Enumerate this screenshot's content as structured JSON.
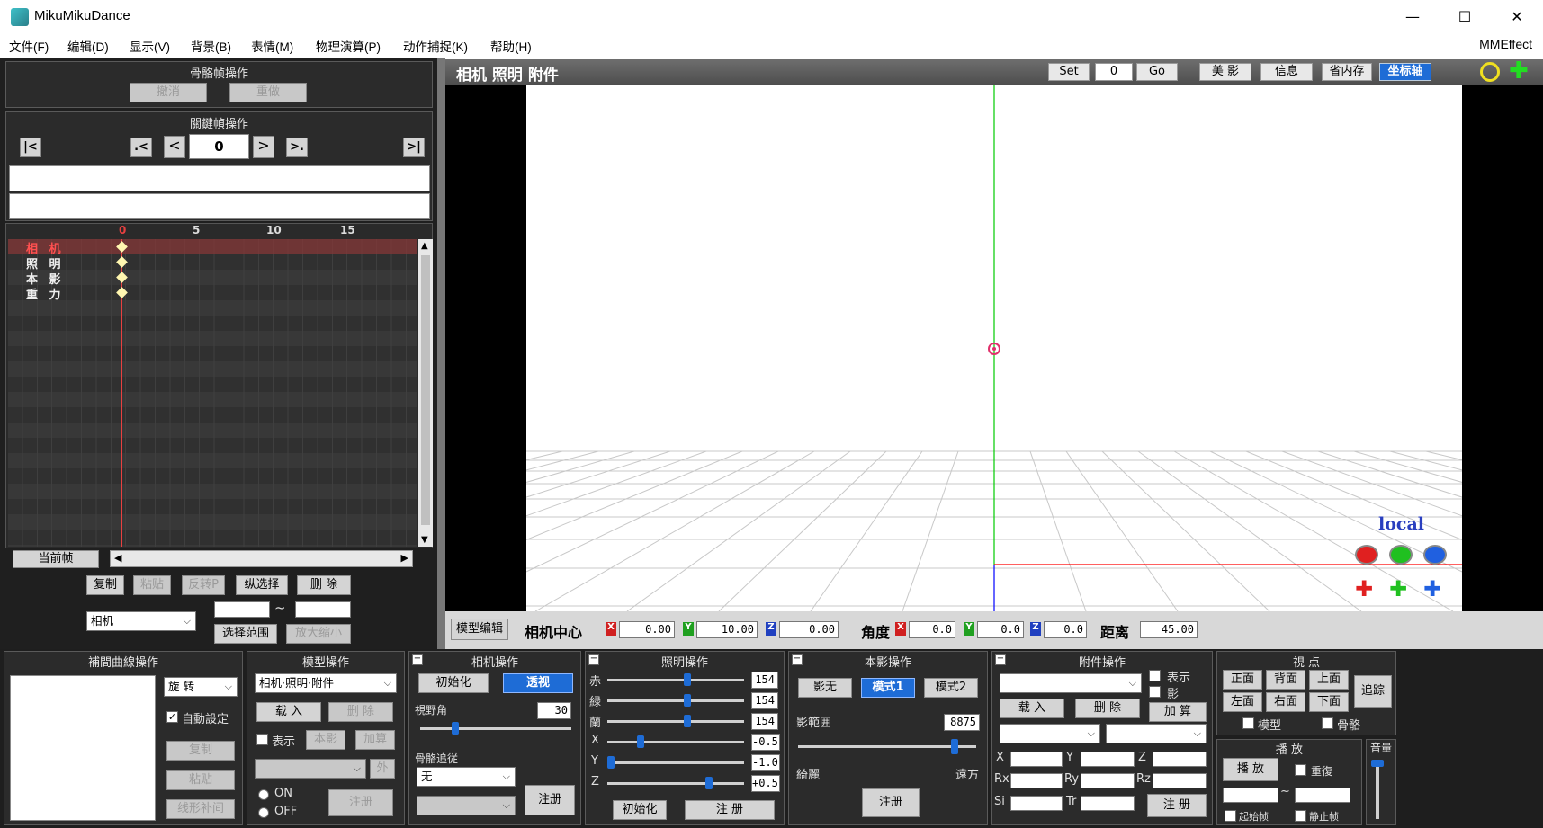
{
  "window": {
    "title": "MikuMikuDance",
    "controls": {
      "minimize": "—",
      "maximize": "☐",
      "close": "✕"
    }
  },
  "menu": {
    "items": [
      "文件(F)",
      "编辑(D)",
      "显示(V)",
      "背景(B)",
      "表情(M)",
      "物理演算(P)",
      "动作捕捉(K)",
      "帮助(H)"
    ],
    "right": "MMEffect"
  },
  "bone_frame_ops": {
    "title": "骨骼帧操作",
    "undo": "撤消",
    "redo": "重做"
  },
  "keyframe_ops": {
    "title": "關鍵幀操作",
    "first": "|<",
    "prev_key": ".<",
    "prev": "<",
    "frame": "0",
    "next": ">",
    "next_key": ">.",
    "last": ">|"
  },
  "timeline": {
    "ticks": [
      "0",
      "5",
      "10",
      "15"
    ],
    "rows": [
      "相 机",
      "照 明",
      "本 影",
      "重 力"
    ],
    "current_frame_btn": "当前帧"
  },
  "timeline_ops": {
    "copy": "复制",
    "paste": "粘贴",
    "reverse_paste": "反转P",
    "vertical_select": "纵选择",
    "delete": "删 除",
    "target": "相机",
    "range_sep": "~",
    "select_range": "选择范围",
    "zoom": "放大缩小"
  },
  "viewport": {
    "title": "相机 照明 附件",
    "set": "Set",
    "frame": "0",
    "go": "Go",
    "beauty": "美 影",
    "info": "信息",
    "save_mem": "省内存",
    "axis": "坐标轴",
    "local_label": "local"
  },
  "camera_bar": {
    "model_edit": "模型编辑",
    "center_label": "相机中心",
    "cx": "0.00",
    "cy": "10.00",
    "cz": "0.00",
    "angle_label": "角度",
    "ax": "0.0",
    "ay": "0.0",
    "az": "0.0",
    "distance_label": "距离",
    "distance": "45.00",
    "x": "X",
    "y": "Y",
    "z": "Z"
  },
  "interp": {
    "title": "補間曲線操作",
    "type": "旋 转",
    "auto": "自動設定",
    "copy": "复制",
    "paste": "粘贴",
    "linear": "线形补间"
  },
  "model_ops": {
    "title": "模型操作",
    "model": "相机·照明·附件",
    "load": "载 入",
    "delete": "删 除",
    "show": "表示",
    "shadow": "本影",
    "add": "加算",
    "outside": "外",
    "on": "ON",
    "off": "OFF",
    "register": "注册"
  },
  "camera_ops": {
    "title": "相机操作",
    "init": "初始化",
    "perspective": "透视",
    "fov_label": "視野角",
    "fov": "30",
    "bone_follow": "骨骼追従",
    "follow_target": "无",
    "register": "注册"
  },
  "light_ops": {
    "title": "照明操作",
    "r_label": "赤",
    "g_label": "緑",
    "b_label": "蘭",
    "r": "154",
    "g": "154",
    "b": "154",
    "x_label": "X",
    "y_label": "Y",
    "z_label": "Z",
    "x": "-0.5",
    "y": "-1.0",
    "z": "+0.5",
    "init": "初始化",
    "register": "注 册"
  },
  "shadow_ops": {
    "title": "本影操作",
    "none": "影无",
    "mode1": "模式1",
    "mode2": "模式2",
    "range_label": "影範囲",
    "range": "8875",
    "near": "綺麗",
    "far": "遠方",
    "register": "注册"
  },
  "accessory_ops": {
    "title": "附件操作",
    "show": "表示",
    "shadow": "影",
    "load": "载 入",
    "delete": "删 除",
    "add": "加 算",
    "x": "X",
    "y": "Y",
    "z": "Z",
    "rx": "Rx",
    "ry": "Ry",
    "rz": "Rz",
    "si": "Si",
    "tr": "Tr",
    "register": "注 册"
  },
  "view_ops": {
    "title": "視 点",
    "front": "正面",
    "back": "背面",
    "top": "上面",
    "track": "追踪",
    "left": "左面",
    "right": "右面",
    "bottom": "下面",
    "model": "模型",
    "bone": "骨骼"
  },
  "play_ops": {
    "title": "播 放",
    "play": "播 放",
    "repeat": "重復",
    "start": "起始帧",
    "stop": "静止帧",
    "range_sep": "~"
  },
  "volume": {
    "title": "音量"
  },
  "colors": {
    "panel_bg": "#2b2b2b",
    "accent_blue": "#1e6cd6",
    "timeline_red": "#e84040",
    "axis_green": "#00cc00",
    "axis_red": "#ff0000",
    "axis_blue": "#0000ff"
  }
}
